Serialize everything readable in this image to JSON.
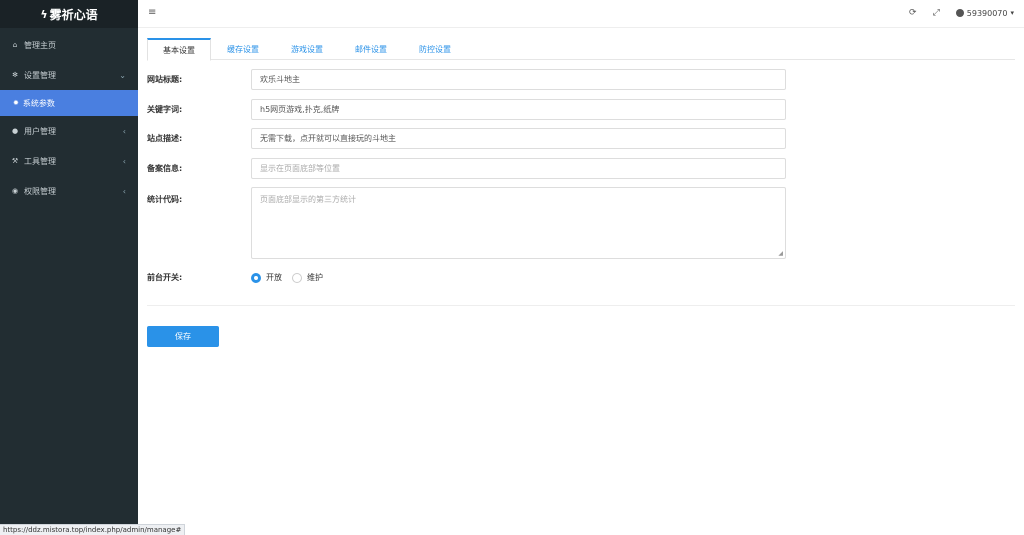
{
  "brand": {
    "icon": "bolt-icon",
    "title": "雾祈心语"
  },
  "sidebar": {
    "items": [
      {
        "label": "管理主页",
        "icon": "home-icon"
      },
      {
        "label": "设置管理",
        "icon": "cogs-icon",
        "chevron": "⌄"
      },
      {
        "label": "系统参数",
        "icon": "gear-icon",
        "active": true
      },
      {
        "label": "用户管理",
        "icon": "users-icon",
        "chevron": "‹"
      },
      {
        "label": "工具管理",
        "icon": "wrench-icon",
        "chevron": "‹"
      },
      {
        "label": "权限管理",
        "icon": "user-circle-icon",
        "chevron": "‹"
      }
    ]
  },
  "topbar": {
    "menu_icon": "≡",
    "refresh_icon": "⟳",
    "fullscreen_icon": "⤢",
    "username": "59390070",
    "caret": "▾"
  },
  "tabs": [
    {
      "label": "基本设置",
      "active": true
    },
    {
      "label": "缓存设置"
    },
    {
      "label": "游戏设置"
    },
    {
      "label": "邮件设置"
    },
    {
      "label": "防控设置"
    }
  ],
  "form": {
    "site_title": {
      "label": "网站标题:",
      "value": "欢乐斗地主"
    },
    "keywords": {
      "label": "关键字词:",
      "value": "h5网页游戏,扑克,纸牌"
    },
    "description": {
      "label": "站点描述:",
      "value": "无需下载，点开就可以直接玩的斗地主"
    },
    "icp": {
      "label": "备案信息:",
      "placeholder": "显示在页面底部等位置"
    },
    "stats_code": {
      "label": "统计代码:",
      "placeholder": "页面底部显示的第三方统计"
    },
    "frontend_switch": {
      "label": "前台开关:",
      "options": [
        "开放",
        "维护"
      ],
      "selected": "开放"
    }
  },
  "save_label": "保存",
  "status_url": "https://ddz.mistora.top/index.php/admin/manage#"
}
